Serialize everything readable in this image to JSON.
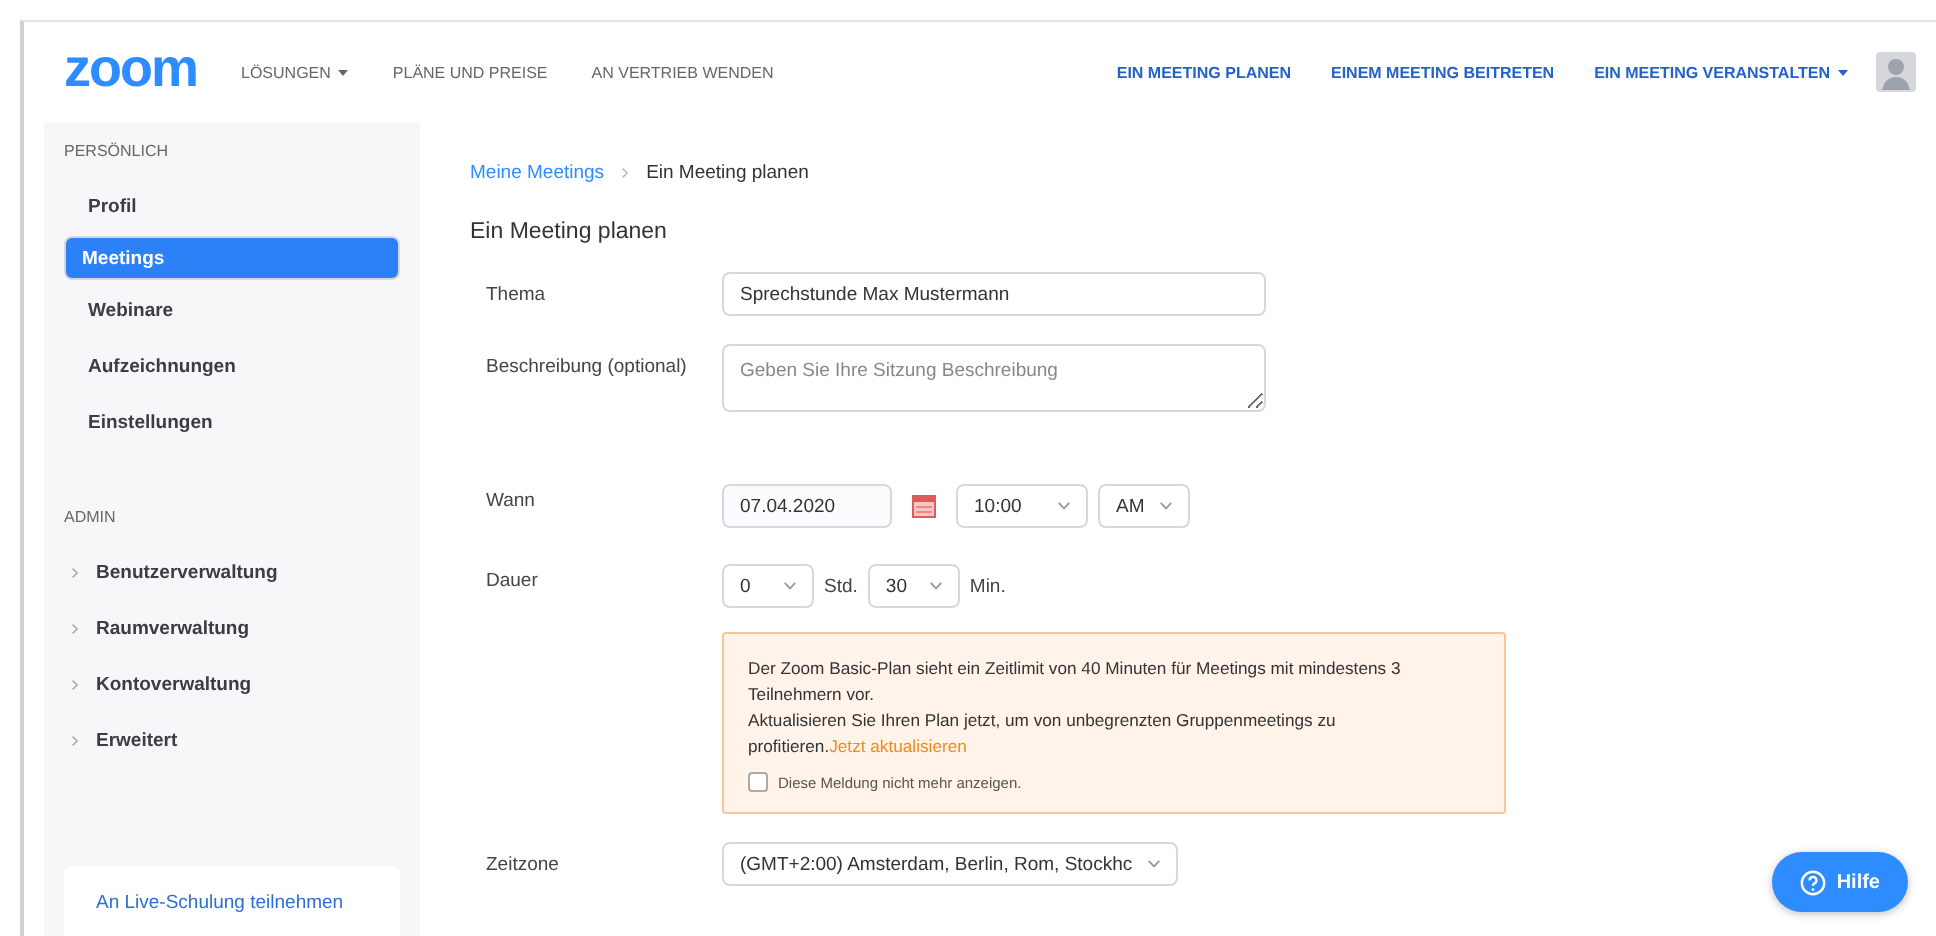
{
  "header": {
    "logo": "zoom",
    "nav": [
      {
        "label": "LÖSUNGEN",
        "dropdown": true
      },
      {
        "label": "PLÄNE UND PREISE",
        "dropdown": false
      },
      {
        "label": "AN VERTRIEB WENDEN",
        "dropdown": false
      }
    ],
    "actions": [
      {
        "label": "EIN MEETING PLANEN",
        "dropdown": false
      },
      {
        "label": "EINEM MEETING BEITRETEN",
        "dropdown": false
      },
      {
        "label": "EIN MEETING VERANSTALTEN",
        "dropdown": true
      }
    ]
  },
  "sidebar": {
    "sections": [
      {
        "heading": "PERSÖNLICH",
        "items": [
          {
            "label": "Profil",
            "selected": false,
            "expandable": false
          },
          {
            "label": "Meetings",
            "selected": true,
            "expandable": false
          },
          {
            "label": "Webinare",
            "selected": false,
            "expandable": false
          },
          {
            "label": "Aufzeichnungen",
            "selected": false,
            "expandable": false
          },
          {
            "label": "Einstellungen",
            "selected": false,
            "expandable": false
          }
        ]
      },
      {
        "heading": "ADMIN",
        "items": [
          {
            "label": "Benutzerverwaltung",
            "selected": false,
            "expandable": true
          },
          {
            "label": "Raumverwaltung",
            "selected": false,
            "expandable": true
          },
          {
            "label": "Kontoverwaltung",
            "selected": false,
            "expandable": true
          },
          {
            "label": "Erweitert",
            "selected": false,
            "expandable": true
          }
        ]
      }
    ],
    "footer_link": "An Live-Schulung teilnehmen"
  },
  "breadcrumb": {
    "parent": "Meine Meetings",
    "current": "Ein Meeting planen"
  },
  "page_title": "Ein Meeting planen",
  "form": [
    {
      "kind": "text",
      "label": "Thema",
      "value": "Sprechstunde Max Mustermann"
    },
    {
      "kind": "textarea",
      "label": "Beschreibung (optional)",
      "placeholder": "Geben Sie Ihre Sitzung Beschreibung"
    },
    {
      "kind": "datetime",
      "label": "Wann",
      "date": "07.04.2020",
      "time": "10:00",
      "period": "AM"
    },
    {
      "kind": "duration",
      "label": "Dauer",
      "hours": "0",
      "hours_unit": "Std.",
      "minutes": "30",
      "minutes_unit": "Min."
    },
    {
      "kind": "notice",
      "lines": [
        "Der Zoom Basic-Plan sieht ein Zeitlimit von 40 Minuten für Meetings mit mindestens 3 Teilnehmern vor.",
        "Aktualisieren Sie Ihren Plan jetzt, um von unbegrenzten Gruppenmeetings zu profitieren."
      ],
      "link": "Jetzt aktualisieren",
      "checkbox": {
        "label": "Diese Meldung nicht mehr anzeigen.",
        "checked": false
      }
    },
    {
      "kind": "select",
      "label": "Zeitzone",
      "value": "(GMT+2:00) Amsterdam, Berlin, Rom, Stockhc"
    }
  ],
  "help_button": "Hilfe"
}
